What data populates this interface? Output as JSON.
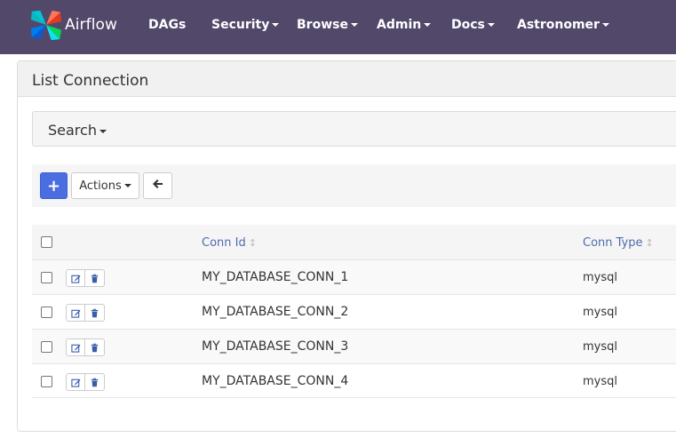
{
  "navbar": {
    "brand": "Airflow",
    "items": [
      {
        "label": "DAGs",
        "dropdown": false
      },
      {
        "label": "Security",
        "dropdown": true
      },
      {
        "label": "Browse",
        "dropdown": true
      },
      {
        "label": "Admin",
        "dropdown": true
      },
      {
        "label": "Docs",
        "dropdown": true
      },
      {
        "label": "Astronomer",
        "dropdown": true
      }
    ]
  },
  "panel": {
    "title": "List Connection",
    "search_label": "Search",
    "toolbar": {
      "add_label": "+",
      "actions_label": "Actions"
    }
  },
  "table": {
    "headers": {
      "conn_id": "Conn Id",
      "conn_type": "Conn Type"
    },
    "rows": [
      {
        "conn_id": "MY_DATABASE_CONN_1",
        "conn_type": "mysql"
      },
      {
        "conn_id": "MY_DATABASE_CONN_2",
        "conn_type": "mysql"
      },
      {
        "conn_id": "MY_DATABASE_CONN_3",
        "conn_type": "mysql"
      },
      {
        "conn_id": "MY_DATABASE_CONN_4",
        "conn_type": "mysql"
      }
    ]
  },
  "icons": {
    "brand": "airflow-pinwheel-icon",
    "back": "arrow-left-icon",
    "edit": "edit-icon",
    "delete": "trash-icon",
    "sort": "sort-icon"
  },
  "colors": {
    "navbar": "#51486a",
    "primary_button": "#4a6de0",
    "header_link": "#4f6bad"
  }
}
